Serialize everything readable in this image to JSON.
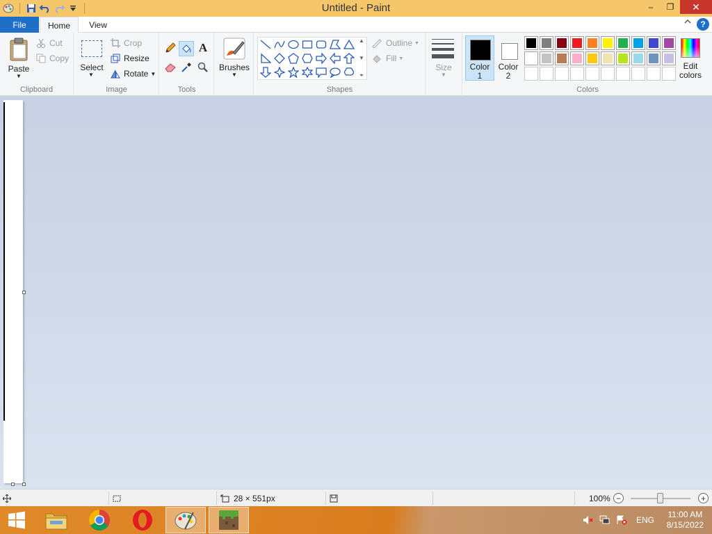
{
  "window": {
    "title": "Untitled - Paint",
    "minimize": "‒",
    "restore": "❐",
    "close": "✕"
  },
  "tabs": {
    "file": "File",
    "home": "Home",
    "view": "View",
    "help": "?"
  },
  "clipboard": {
    "paste": "Paste",
    "cut": "Cut",
    "copy": "Copy",
    "label": "Clipboard"
  },
  "image": {
    "select": "Select",
    "crop": "Crop",
    "resize": "Resize",
    "rotate": "Rotate",
    "label": "Image"
  },
  "tools": {
    "label": "Tools"
  },
  "brushes": {
    "label": "Brushes"
  },
  "shapes": {
    "outline": "Outline",
    "fill": "Fill",
    "label": "Shapes"
  },
  "size": {
    "label": "Size"
  },
  "colors": {
    "color1_line1": "Color",
    "color1_line2": "1",
    "color2_line1": "Color",
    "color2_line2": "2",
    "edit_line1": "Edit",
    "edit_line2": "colors",
    "label": "Colors",
    "color1_value": "#000000",
    "color2_value": "#ffffff",
    "palette_row1": [
      "#000000",
      "#7f7f7f",
      "#880015",
      "#ed1c24",
      "#ff7f27",
      "#fff200",
      "#22b14c",
      "#00a2e8",
      "#3f48cc",
      "#a349a4"
    ],
    "palette_row2": [
      "#ffffff",
      "#c3c3c3",
      "#b97a57",
      "#ffaec9",
      "#ffc90e",
      "#efe4b0",
      "#b5e61d",
      "#99d9ea",
      "#7092be",
      "#c8bfe7"
    ]
  },
  "status": {
    "dimensions": "28 × 551px",
    "zoom": "100%"
  },
  "taskbar": {
    "language": "ENG",
    "time": "11:00 AM",
    "date": "8/15/2022"
  }
}
